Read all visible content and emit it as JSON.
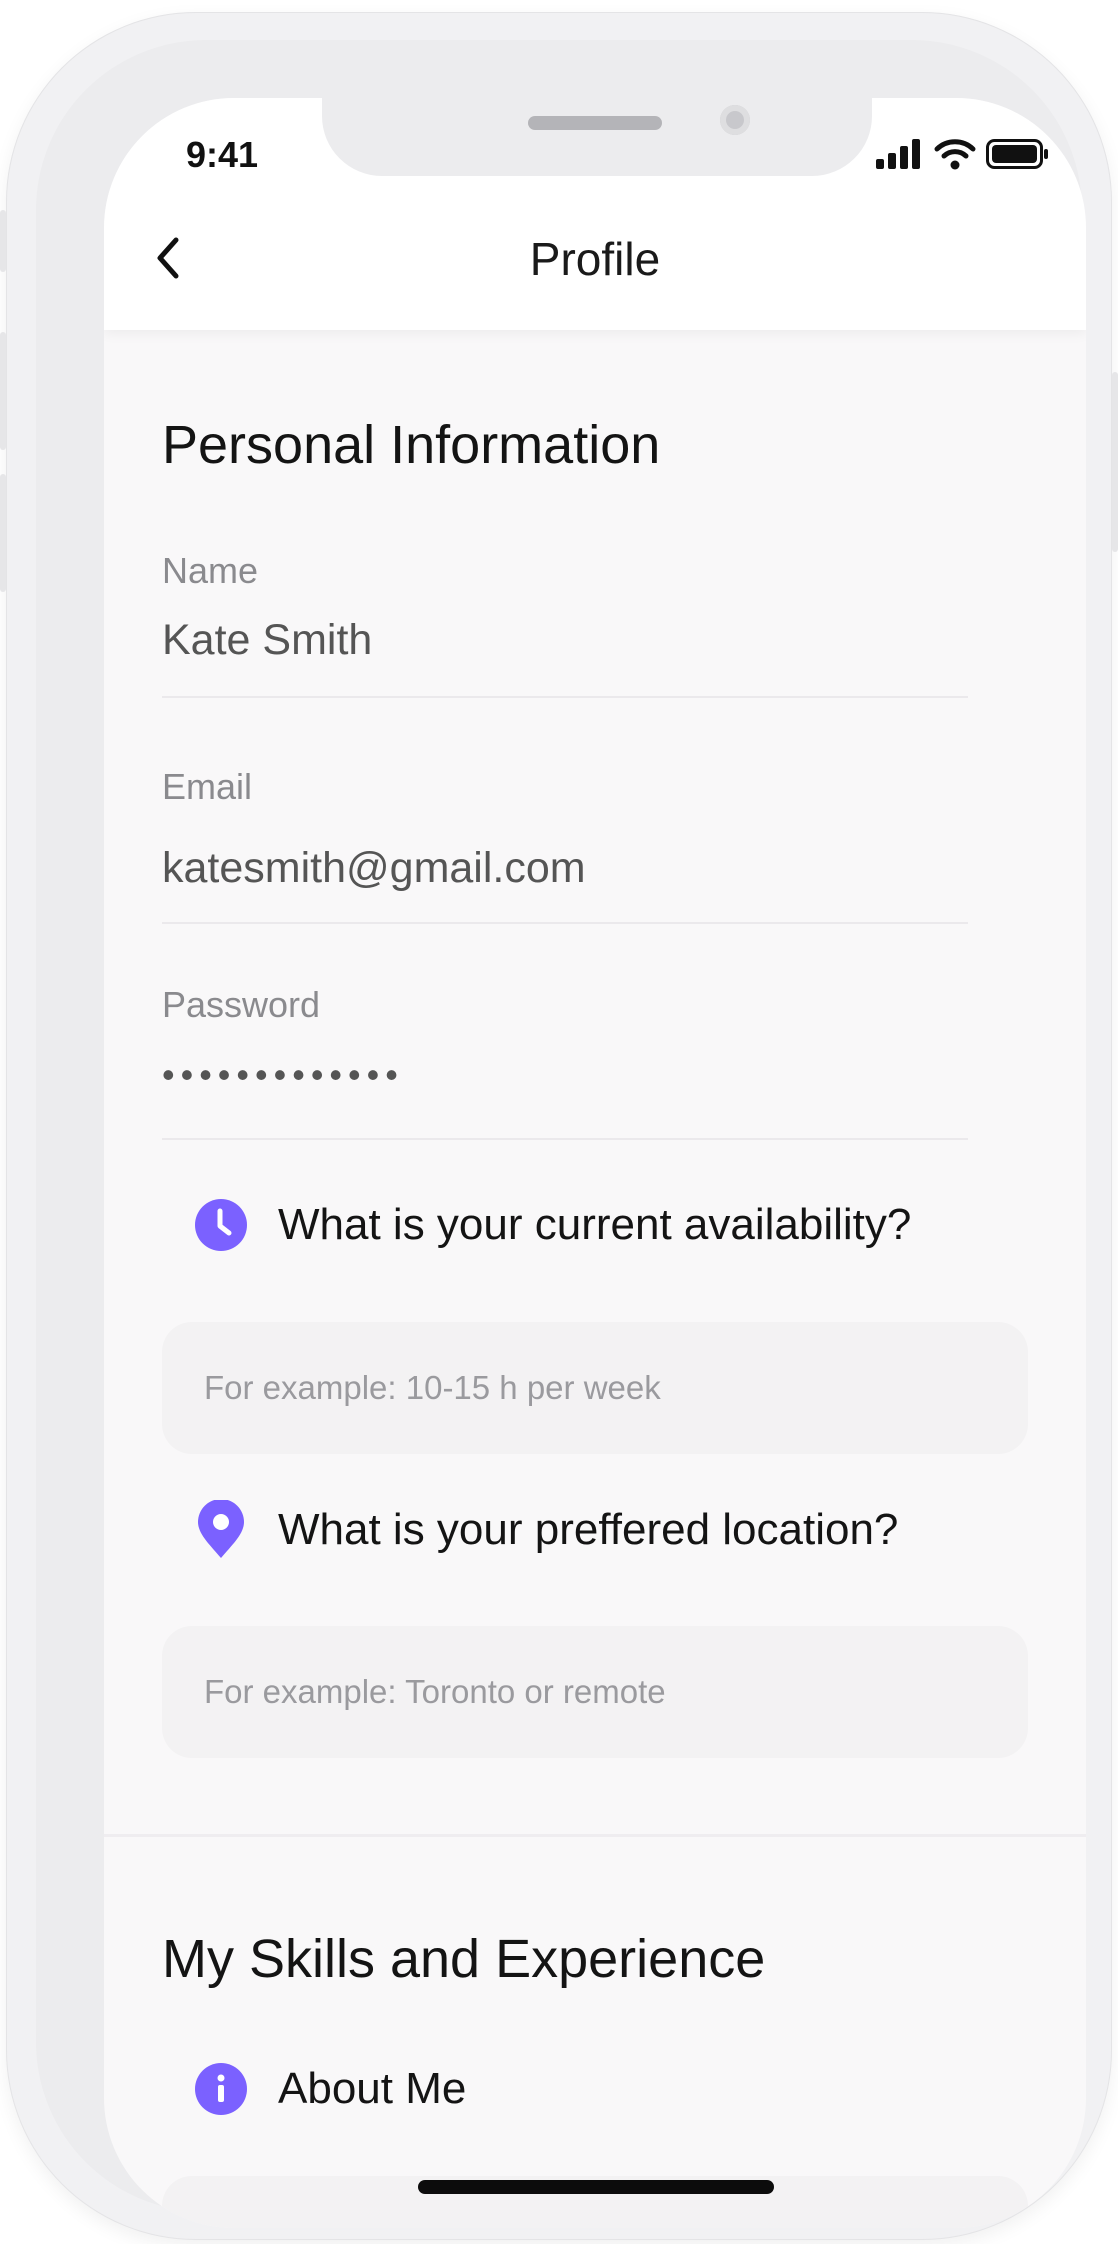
{
  "status_bar": {
    "time": "9:41"
  },
  "header": {
    "title": "Profile"
  },
  "personal": {
    "title": "Personal Information",
    "name_label": "Name",
    "name_value": "Kate Smith",
    "email_label": "Email",
    "email_value": "katesmith@gmail.com",
    "password_label": "Password",
    "password_value": "•••••••••••••"
  },
  "availability": {
    "question": "What is your current availability?",
    "placeholder": "For example: 10-15 h per week"
  },
  "location": {
    "question": "What is your preffered location?",
    "placeholder": "For example: Toronto or remote"
  },
  "skills": {
    "title": "My Skills and Experience",
    "about_label": "About Me"
  },
  "colors": {
    "accent": "#7b61ff",
    "accent_dark": "#6a4ff0"
  },
  "icons": [
    "back-chevron-icon",
    "signal-icon",
    "wifi-icon",
    "battery-icon",
    "clock-icon",
    "location-pin-icon",
    "info-icon"
  ]
}
